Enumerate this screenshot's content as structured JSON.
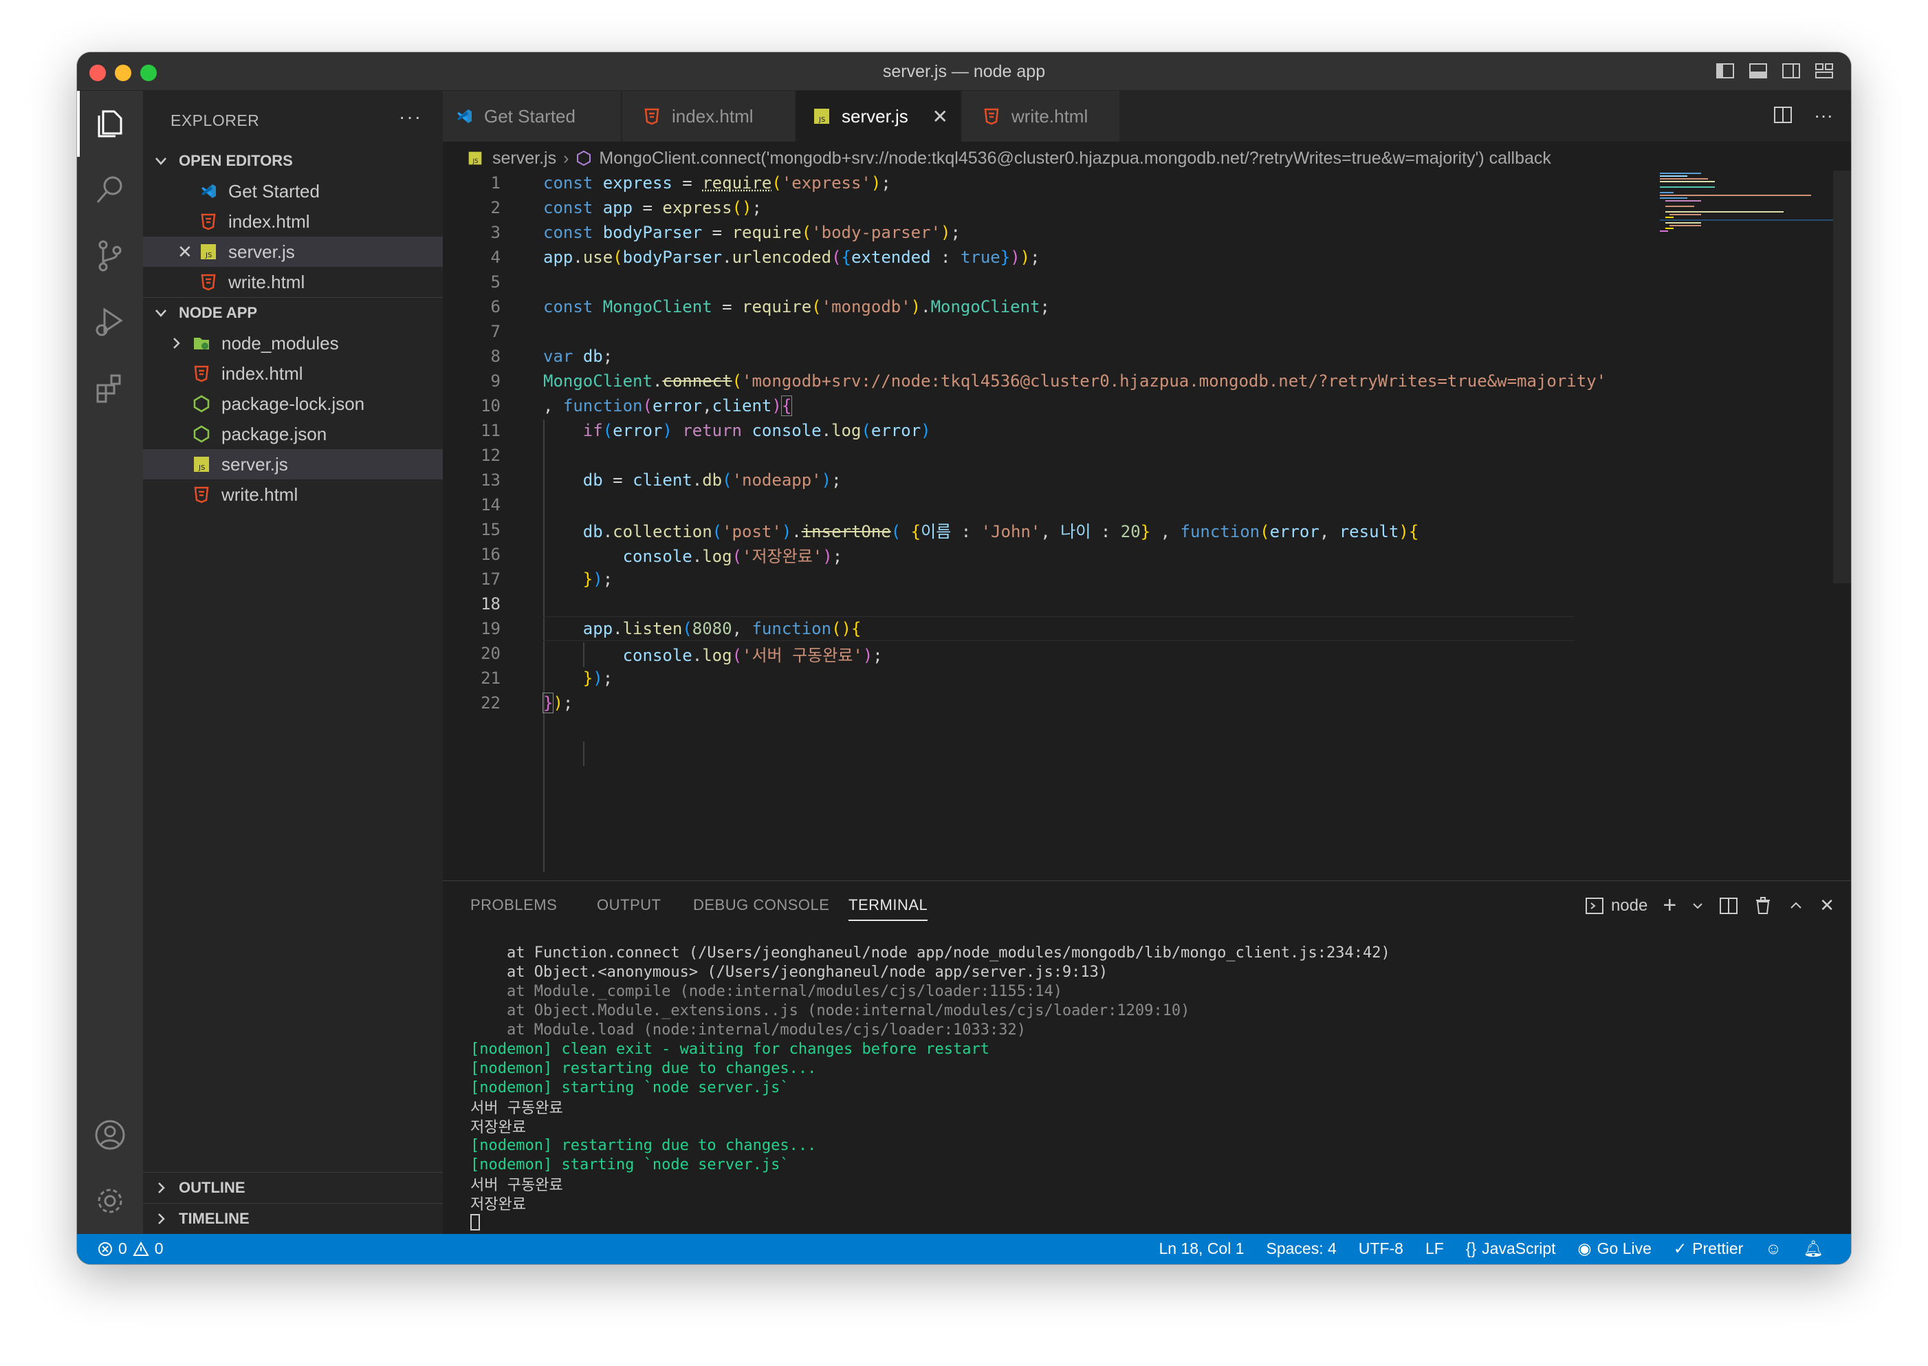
{
  "window": {
    "title": "server.js — node app"
  },
  "explorer": {
    "header": "EXPLORER",
    "more": "···",
    "open_editors_label": "OPEN EDITORS",
    "open_editors": [
      {
        "label": "Get Started",
        "icon": "vscode-icon"
      },
      {
        "label": "index.html",
        "icon": "html-icon"
      },
      {
        "label": "server.js",
        "icon": "js-icon",
        "selected": true
      },
      {
        "label": "write.html",
        "icon": "html-icon"
      }
    ],
    "folder_label": "NODE APP",
    "files": [
      {
        "label": "node_modules",
        "icon": "folder-icon"
      },
      {
        "label": "index.html",
        "icon": "html-icon"
      },
      {
        "label": "package-lock.json",
        "icon": "node-icon"
      },
      {
        "label": "package.json",
        "icon": "node-icon"
      },
      {
        "label": "server.js",
        "icon": "js-icon",
        "selected": true
      },
      {
        "label": "write.html",
        "icon": "html-icon"
      }
    ],
    "outline_label": "OUTLINE",
    "timeline_label": "TIMELINE"
  },
  "tabs": [
    {
      "label": "Get Started",
      "icon": "vscode-icon"
    },
    {
      "label": "index.html",
      "icon": "html-icon"
    },
    {
      "label": "server.js",
      "icon": "js-icon",
      "active": true
    },
    {
      "label": "write.html",
      "icon": "html-icon"
    }
  ],
  "breadcrumbs": {
    "file": "server.js",
    "symbol": "MongoClient.connect('mongodb+srv://node:tkql4536@cluster0.hjazpua.mongodb.net/?retryWrites=true&w=majority') callback"
  },
  "code": {
    "current_line": 18,
    "lines": [
      {
        "n": "1"
      },
      {
        "n": "2"
      },
      {
        "n": "3"
      },
      {
        "n": "4"
      },
      {
        "n": "5"
      },
      {
        "n": "6"
      },
      {
        "n": "7"
      },
      {
        "n": "8"
      },
      {
        "n": "9"
      },
      {
        "n": "10"
      },
      {
        "n": "11"
      },
      {
        "n": "12"
      },
      {
        "n": "13"
      },
      {
        "n": "14"
      },
      {
        "n": "15"
      },
      {
        "n": "16"
      },
      {
        "n": "17"
      },
      {
        "n": "18"
      },
      {
        "n": "19"
      },
      {
        "n": "20"
      },
      {
        "n": "21"
      },
      {
        "n": "22"
      }
    ],
    "tokens": {
      "l1": [
        "const",
        "express",
        "=",
        "require",
        "('express');"
      ],
      "str_express": "'express'",
      "str_bodyparser": "'body-parser'",
      "str_mongodb": "'mongodb'",
      "uri": "'mongodb+srv://node:tkql4536@cluster0.hjazpua.mongodb.net/?retryWrites=true&w=majority'",
      "str_nodeapp": "'nodeapp'",
      "str_post": "'post'",
      "str_john": "'John'",
      "str_saved": "'저장완료'",
      "str_server": "'서버 구동완료'",
      "key_name": "이름",
      "key_age": "나이",
      "num_age": "20",
      "num_port": "8080"
    }
  },
  "panel": {
    "tabs": [
      "PROBLEMS",
      "OUTPUT",
      "DEBUG CONSOLE",
      "TERMINAL"
    ],
    "active_tab": "TERMINAL",
    "terminal_name": "node",
    "terminal": [
      "    at Function.connect (/Users/jeonghaneul/node app/node_modules/mongodb/lib/mongo_client.js:234:42)",
      "    at Object.<anonymous> (/Users/jeonghaneul/node app/server.js:9:13)",
      "    at Module._compile (node:internal/modules/cjs/loader:1155:14)",
      "    at Object.Module._extensions..js (node:internal/modules/cjs/loader:1209:10)",
      "    at Module.load (node:internal/modules/cjs/loader:1033:32)",
      "[nodemon] clean exit - waiting for changes before restart",
      "[nodemon] restarting due to changes...",
      "[nodemon] starting `node server.js`",
      "서버 구동완료",
      "저장완료",
      "[nodemon] restarting due to changes...",
      "[nodemon] starting `node server.js`",
      "서버 구동완료",
      "저장완료"
    ]
  },
  "status": {
    "errors": "0",
    "warnings": "0",
    "position": "Ln 18, Col 1",
    "spaces": "Spaces: 4",
    "encoding": "UTF-8",
    "eol": "LF",
    "language": "JavaScript",
    "golive": "Go Live",
    "prettier": "Prettier"
  },
  "colors": {
    "statusbar": "#007acc",
    "editor_bg": "#1e1e1e",
    "sidebar_bg": "#252526",
    "activity_bg": "#333333"
  }
}
